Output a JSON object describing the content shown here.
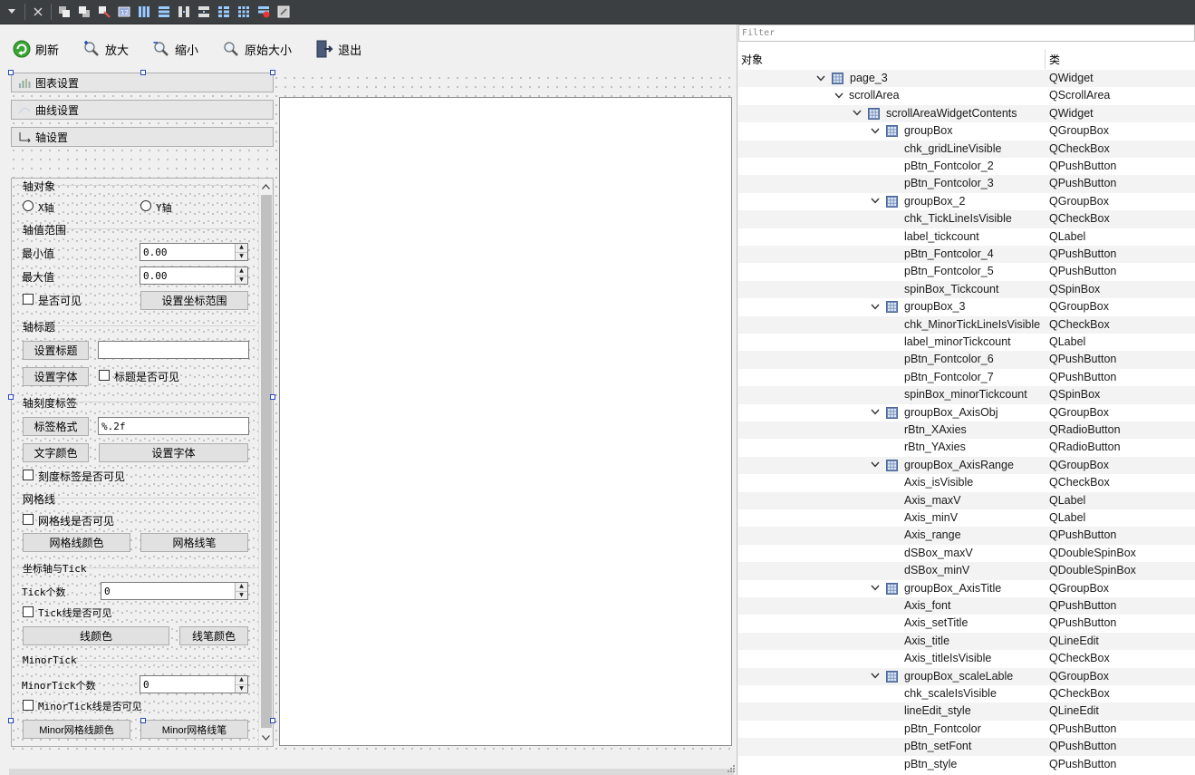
{
  "toolbar": {
    "refresh": "刷新",
    "zoom_in": "放大",
    "zoom_out": "缩小",
    "original_size": "原始大小",
    "exit": "退出"
  },
  "side_buttons": {
    "chart_settings": "图表设置",
    "curve_settings": "曲线设置",
    "axis_settings": "轴设置"
  },
  "axis_panel": {
    "axis_object": {
      "title": "轴对象",
      "x_axis": "X轴",
      "y_axis": "Y轴"
    },
    "axis_range": {
      "title": "轴值范围",
      "min_label": "最小值",
      "min_value": "0.00",
      "max_label": "最大值",
      "max_value": "0.00",
      "visible_label": "是否可见",
      "set_range_button": "设置坐标范围"
    },
    "axis_title": {
      "title": "轴标题",
      "set_title_button": "设置标题",
      "title_value": "",
      "set_font_button": "设置字体",
      "title_visible_label": "标题是否可见"
    },
    "scale_label": {
      "title": "轴刻度标签",
      "format_button": "标签格式",
      "format_value": "%.2f",
      "text_color_button": "文字颜色",
      "set_font_button": "设置字体",
      "scale_visible_label": "刻度标签是否可见"
    },
    "grid_line": {
      "title": "网格线",
      "grid_visible_label": "网格线是否可见",
      "grid_color_button": "网格线颜色",
      "grid_pen_button": "网格线笔"
    },
    "tick": {
      "title": "坐标轴与Tick",
      "tick_count_label": "Tick个数",
      "tick_count_value": "0",
      "tick_visible_label": "Tick线是否可见",
      "line_color_button": "线颜色",
      "pen_color_button": "线笔颜色"
    },
    "minor_tick": {
      "title": "MinorTick",
      "count_label": "MinorTick个数",
      "count_value": "0",
      "visible_label": "MinorTick线是否可见",
      "grid_color_button": "Minor网格线颜色",
      "grid_pen_button": "Minor网格线笔"
    }
  },
  "inspector": {
    "filter_placeholder": "Filter",
    "col_object": "对象",
    "col_class": "类",
    "rows": [
      {
        "name": "page_3",
        "cls": "QWidget",
        "depth": 0,
        "expander": true,
        "icon": true
      },
      {
        "name": "scrollArea",
        "cls": "QScrollArea",
        "depth": 1,
        "expander": true,
        "icon": false
      },
      {
        "name": "scrollAreaWidgetContents",
        "cls": "QWidget",
        "depth": 2,
        "expander": true,
        "icon": true
      },
      {
        "name": "groupBox",
        "cls": "QGroupBox",
        "depth": 3,
        "expander": true,
        "icon": true
      },
      {
        "name": "chk_gridLineVisible",
        "cls": "QCheckBox",
        "depth": 4,
        "expander": false,
        "icon": false
      },
      {
        "name": "pBtn_Fontcolor_2",
        "cls": "QPushButton",
        "depth": 4,
        "expander": false,
        "icon": false
      },
      {
        "name": "pBtn_Fontcolor_3",
        "cls": "QPushButton",
        "depth": 4,
        "expander": false,
        "icon": false
      },
      {
        "name": "groupBox_2",
        "cls": "QGroupBox",
        "depth": 3,
        "expander": true,
        "icon": true
      },
      {
        "name": "chk_TickLineIsVisible",
        "cls": "QCheckBox",
        "depth": 4,
        "expander": false,
        "icon": false
      },
      {
        "name": "label_tickcount",
        "cls": "QLabel",
        "depth": 4,
        "expander": false,
        "icon": false
      },
      {
        "name": "pBtn_Fontcolor_4",
        "cls": "QPushButton",
        "depth": 4,
        "expander": false,
        "icon": false
      },
      {
        "name": "pBtn_Fontcolor_5",
        "cls": "QPushButton",
        "depth": 4,
        "expander": false,
        "icon": false
      },
      {
        "name": "spinBox_Tickcount",
        "cls": "QSpinBox",
        "depth": 4,
        "expander": false,
        "icon": false
      },
      {
        "name": "groupBox_3",
        "cls": "QGroupBox",
        "depth": 3,
        "expander": true,
        "icon": true
      },
      {
        "name": "chk_MinorTickLineIsVisible",
        "cls": "QCheckBox",
        "depth": 4,
        "expander": false,
        "icon": false
      },
      {
        "name": "label_minorTickcount",
        "cls": "QLabel",
        "depth": 4,
        "expander": false,
        "icon": false
      },
      {
        "name": "pBtn_Fontcolor_6",
        "cls": "QPushButton",
        "depth": 4,
        "expander": false,
        "icon": false
      },
      {
        "name": "pBtn_Fontcolor_7",
        "cls": "QPushButton",
        "depth": 4,
        "expander": false,
        "icon": false
      },
      {
        "name": "spinBox_minorTickcount",
        "cls": "QSpinBox",
        "depth": 4,
        "expander": false,
        "icon": false
      },
      {
        "name": "groupBox_AxisObj",
        "cls": "QGroupBox",
        "depth": 3,
        "expander": true,
        "icon": true
      },
      {
        "name": "rBtn_XAxies",
        "cls": "QRadioButton",
        "depth": 4,
        "expander": false,
        "icon": false
      },
      {
        "name": "rBtn_YAxies",
        "cls": "QRadioButton",
        "depth": 4,
        "expander": false,
        "icon": false
      },
      {
        "name": "groupBox_AxisRange",
        "cls": "QGroupBox",
        "depth": 3,
        "expander": true,
        "icon": true
      },
      {
        "name": "Axis_isVisible",
        "cls": "QCheckBox",
        "depth": 4,
        "expander": false,
        "icon": false
      },
      {
        "name": "Axis_maxV",
        "cls": "QLabel",
        "depth": 4,
        "expander": false,
        "icon": false
      },
      {
        "name": "Axis_minV",
        "cls": "QLabel",
        "depth": 4,
        "expander": false,
        "icon": false
      },
      {
        "name": "Axis_range",
        "cls": "QPushButton",
        "depth": 4,
        "expander": false,
        "icon": false
      },
      {
        "name": "dSBox_maxV",
        "cls": "QDoubleSpinBox",
        "depth": 4,
        "expander": false,
        "icon": false
      },
      {
        "name": "dSBox_minV",
        "cls": "QDoubleSpinBox",
        "depth": 4,
        "expander": false,
        "icon": false
      },
      {
        "name": "groupBox_AxisTitle",
        "cls": "QGroupBox",
        "depth": 3,
        "expander": true,
        "icon": true
      },
      {
        "name": "Axis_font",
        "cls": "QPushButton",
        "depth": 4,
        "expander": false,
        "icon": false
      },
      {
        "name": "Axis_setTitle",
        "cls": "QPushButton",
        "depth": 4,
        "expander": false,
        "icon": false
      },
      {
        "name": "Axis_title",
        "cls": "QLineEdit",
        "depth": 4,
        "expander": false,
        "icon": false
      },
      {
        "name": "Axis_titleIsVisible",
        "cls": "QCheckBox",
        "depth": 4,
        "expander": false,
        "icon": false
      },
      {
        "name": "groupBox_scaleLable",
        "cls": "QGroupBox",
        "depth": 3,
        "expander": true,
        "icon": true
      },
      {
        "name": "chk_scaleIsVisible",
        "cls": "QCheckBox",
        "depth": 4,
        "expander": false,
        "icon": false
      },
      {
        "name": "lineEdit_style",
        "cls": "QLineEdit",
        "depth": 4,
        "expander": false,
        "icon": false
      },
      {
        "name": "pBtn_Fontcolor",
        "cls": "QPushButton",
        "depth": 4,
        "expander": false,
        "icon": false
      },
      {
        "name": "pBtn_setFont",
        "cls": "QPushButton",
        "depth": 4,
        "expander": false,
        "icon": false
      },
      {
        "name": "pBtn_style",
        "cls": "QPushButton",
        "depth": 4,
        "expander": false,
        "icon": false
      }
    ]
  }
}
